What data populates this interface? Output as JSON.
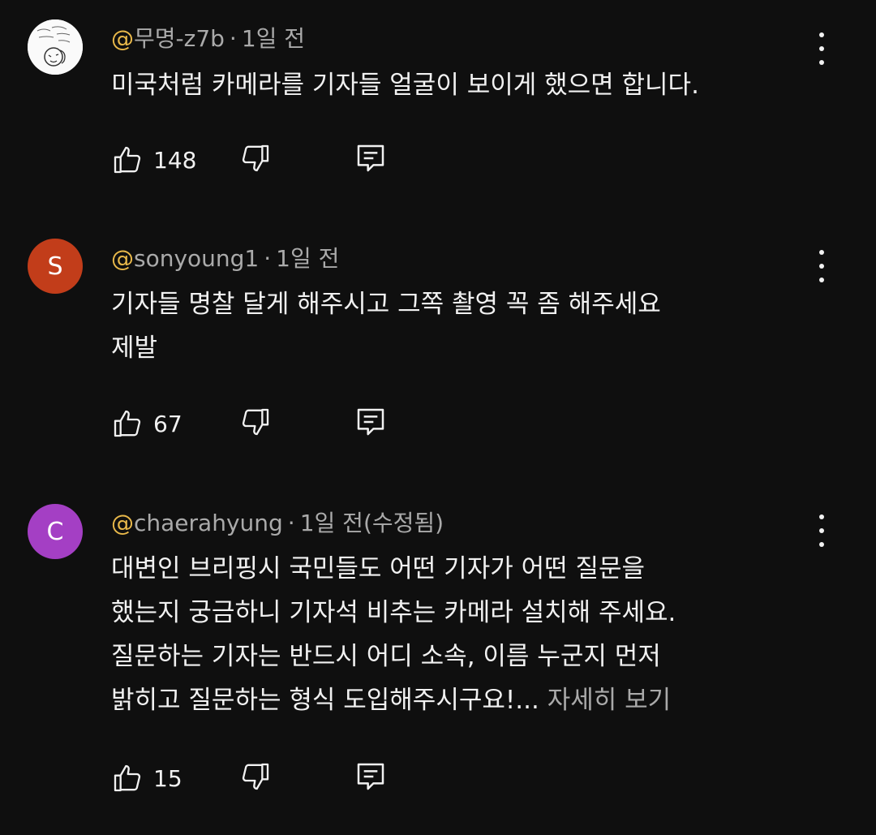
{
  "comments": [
    {
      "handle_prefix": "@",
      "handle": "무명-z7b",
      "time": "1일 전",
      "edited": "",
      "avatar": {
        "type": "image"
      },
      "lines": [
        "미국처럼 카메라를 기자들 얼굴이 보이게 했으면 합니다."
      ],
      "more": "",
      "likes": "148"
    },
    {
      "handle_prefix": "@",
      "handle": "sonyoung1",
      "time": "1일 전",
      "edited": "",
      "avatar": {
        "type": "letter",
        "letter": "S",
        "color": "#c23d1a"
      },
      "lines": [
        "기자들 명찰 달게 해주시고 그쪽 촬영 꼭 좀 해주세요",
        "제발"
      ],
      "more": "",
      "likes": "67"
    },
    {
      "handle_prefix": "@",
      "handle": "chaerahyung",
      "time": "1일 전",
      "edited": "(수정됨)",
      "avatar": {
        "type": "letter",
        "letter": "C",
        "color": "#a43fc4"
      },
      "lines": [
        "대변인 브리핑시 국민들도 어떤 기자가 어떤 질문을",
        "했는지 궁금하니 기자석 비추는 카메라 설치해 주세요.",
        "질문하는 기자는 반드시 어디 소속, 이름 누군지 먼저",
        "밝히고 질문하는 형식 도입해주시구요!..."
      ],
      "more": "자세히 보기",
      "likes": "15"
    }
  ],
  "separator": "·",
  "icons": {
    "like": "thumb-up-icon",
    "dislike": "thumb-down-icon",
    "reply": "reply-icon",
    "menu": "more-vert-icon"
  },
  "colors": {
    "background": "#0f0f0f",
    "handle_at": "#e8b84a",
    "meta": "#aaaaaa",
    "text": "#f1f1f1"
  }
}
